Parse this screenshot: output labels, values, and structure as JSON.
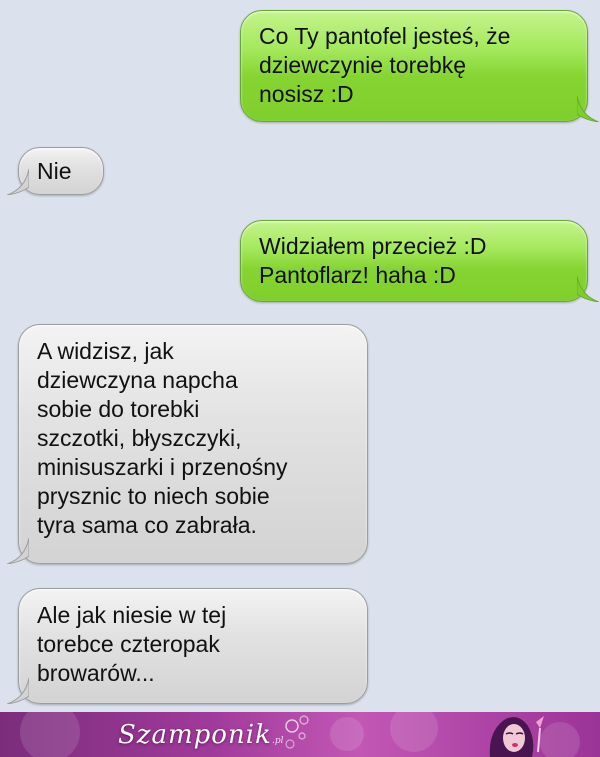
{
  "messages": [
    {
      "type": "sent",
      "text": "Co Ty pantofel jesteś, że\ndziewczynie torebkę\nnosisz :D"
    },
    {
      "type": "received",
      "text": "Nie"
    },
    {
      "type": "sent",
      "text": "Widziałem przecież :D\nPantoflarz! haha :D"
    },
    {
      "type": "received",
      "text": "A widzisz, jak\ndziewczyna napcha\nsobie do torebki\nszczotki, błyszczyki,\nminisuszarki i przenośny\nprysznic to niech sobie\ntyra sama co zabrała."
    },
    {
      "type": "received",
      "text": "Ale jak niesie w tej\ntorebce czteropak\nbrowarów..."
    }
  ],
  "footer": {
    "brand": "Szamponik",
    "brand_suffix": ".pl"
  },
  "colors": {
    "background": "#dbe2ed",
    "sent_bubble": "#86d432",
    "received_bubble": "#d3d3d3",
    "footer_accent": "#a03a9a"
  }
}
